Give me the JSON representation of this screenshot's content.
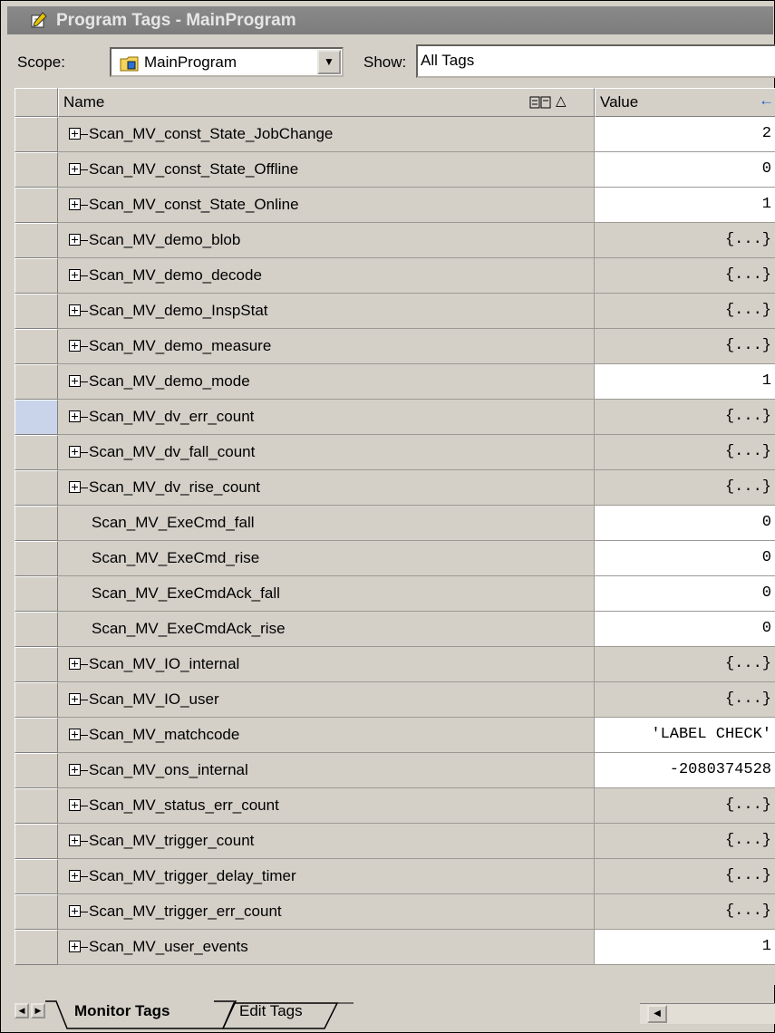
{
  "window": {
    "title": "Program Tags - MainProgram"
  },
  "toolbar": {
    "scope_label": "Scope:",
    "scope_value": "MainProgram",
    "show_label": "Show:",
    "show_value": "All Tags"
  },
  "grid": {
    "columns": {
      "name": "Name",
      "value": "Value"
    },
    "rows": [
      {
        "name": "Scan_MV_const_State_JobChange",
        "value": "2",
        "expandable": true,
        "editable": true
      },
      {
        "name": "Scan_MV_const_State_Offline",
        "value": "0",
        "expandable": true,
        "editable": true
      },
      {
        "name": "Scan_MV_const_State_Online",
        "value": "1",
        "expandable": true,
        "editable": true
      },
      {
        "name": "Scan_MV_demo_blob",
        "value": "{...}",
        "expandable": true,
        "editable": false
      },
      {
        "name": "Scan_MV_demo_decode",
        "value": "{...}",
        "expandable": true,
        "editable": false
      },
      {
        "name": "Scan_MV_demo_InspStat",
        "value": "{...}",
        "expandable": true,
        "editable": false
      },
      {
        "name": "Scan_MV_demo_measure",
        "value": "{...}",
        "expandable": true,
        "editable": false
      },
      {
        "name": "Scan_MV_demo_mode",
        "value": "1",
        "expandable": true,
        "editable": true
      },
      {
        "name": "Scan_MV_dv_err_count",
        "value": "{...}",
        "expandable": true,
        "editable": false,
        "selected": true
      },
      {
        "name": "Scan_MV_dv_fall_count",
        "value": "{...}",
        "expandable": true,
        "editable": false
      },
      {
        "name": "Scan_MV_dv_rise_count",
        "value": "{...}",
        "expandable": true,
        "editable": false
      },
      {
        "name": "Scan_MV_ExeCmd_fall",
        "value": "0",
        "expandable": false,
        "editable": true
      },
      {
        "name": "Scan_MV_ExeCmd_rise",
        "value": "0",
        "expandable": false,
        "editable": true
      },
      {
        "name": "Scan_MV_ExeCmdAck_fall",
        "value": "0",
        "expandable": false,
        "editable": true
      },
      {
        "name": "Scan_MV_ExeCmdAck_rise",
        "value": "0",
        "expandable": false,
        "editable": true
      },
      {
        "name": "Scan_MV_IO_internal",
        "value": "{...}",
        "expandable": true,
        "editable": false
      },
      {
        "name": "Scan_MV_IO_user",
        "value": "{...}",
        "expandable": true,
        "editable": false
      },
      {
        "name": "Scan_MV_matchcode",
        "value": "'LABEL CHECK'",
        "expandable": true,
        "editable": true
      },
      {
        "name": "Scan_MV_ons_internal",
        "value": "-2080374528",
        "expandable": true,
        "editable": true
      },
      {
        "name": "Scan_MV_status_err_count",
        "value": "{...}",
        "expandable": true,
        "editable": false
      },
      {
        "name": "Scan_MV_trigger_count",
        "value": "{...}",
        "expandable": true,
        "editable": false
      },
      {
        "name": "Scan_MV_trigger_delay_timer",
        "value": "{...}",
        "expandable": true,
        "editable": false
      },
      {
        "name": "Scan_MV_trigger_err_count",
        "value": "{...}",
        "expandable": true,
        "editable": false
      },
      {
        "name": "Scan_MV_user_events",
        "value": "1",
        "expandable": true,
        "editable": true
      }
    ]
  },
  "tabs": [
    {
      "label": "Monitor Tags",
      "active": true
    },
    {
      "label": "Edit Tags",
      "active": false
    }
  ],
  "colors": {
    "title_bar": "#8a8a8a",
    "window_bg": "#d4d0c8",
    "selected_row_header": "#c9d4ea",
    "back_arrow": "#1f5fd6"
  }
}
